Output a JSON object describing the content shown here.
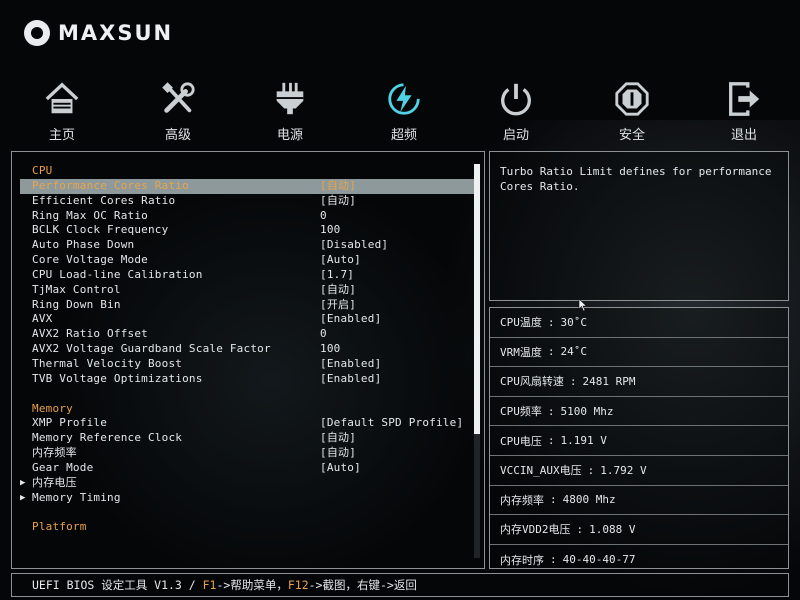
{
  "header": {
    "brand": "MAXSUN"
  },
  "nav": [
    {
      "label": "主页",
      "icon": "home-icon"
    },
    {
      "label": "高级",
      "icon": "tools-icon"
    },
    {
      "label": "电源",
      "icon": "power-plug-icon"
    },
    {
      "label": "超频",
      "icon": "lightning-icon"
    },
    {
      "label": "启动",
      "icon": "power-button-icon"
    },
    {
      "label": "安全",
      "icon": "security-icon"
    },
    {
      "label": "退出",
      "icon": "exit-icon"
    }
  ],
  "active_nav": "超频",
  "settings": {
    "rows": [
      {
        "type": "section",
        "label": "CPU",
        "value": ""
      },
      {
        "type": "item",
        "label": "Performance Cores Ratio",
        "value": "[自动]",
        "selected": true
      },
      {
        "type": "item",
        "label": "Efficient Cores Ratio",
        "value": "[自动]"
      },
      {
        "type": "item",
        "label": "Ring Max OC Ratio",
        "value": "0"
      },
      {
        "type": "item",
        "label": "BCLK Clock Frequency",
        "value": "100"
      },
      {
        "type": "item",
        "label": "Auto Phase Down",
        "value": "[Disabled]"
      },
      {
        "type": "item",
        "label": "Core Voltage Mode",
        "value": "[Auto]"
      },
      {
        "type": "item",
        "label": "CPU Load-line Calibration",
        "value": "[1.7]"
      },
      {
        "type": "item",
        "label": "TjMax Control",
        "value": "[自动]"
      },
      {
        "type": "item",
        "label": "Ring Down Bin",
        "value": "[开启]"
      },
      {
        "type": "item",
        "label": "AVX",
        "value": "[Enabled]"
      },
      {
        "type": "item",
        "label": "AVX2 Ratio Offset",
        "value": "0"
      },
      {
        "type": "item",
        "label": "AVX2 Voltage Guardband Scale Factor",
        "value": "100"
      },
      {
        "type": "item",
        "label": "Thermal Velocity Boost",
        "value": "[Enabled]"
      },
      {
        "type": "item",
        "label": "TVB Voltage Optimizations",
        "value": "[Enabled]"
      },
      {
        "type": "blank",
        "label": "",
        "value": ""
      },
      {
        "type": "section",
        "label": "Memory",
        "value": ""
      },
      {
        "type": "item",
        "label": "XMP Profile",
        "value": "[Default SPD Profile]"
      },
      {
        "type": "item",
        "label": "Memory Reference Clock",
        "value": "[自动]"
      },
      {
        "type": "item",
        "label": "内存频率",
        "value": "[自动]"
      },
      {
        "type": "item",
        "label": "Gear Mode",
        "value": "[Auto]"
      },
      {
        "type": "sub",
        "label": "内存电压",
        "value": ""
      },
      {
        "type": "sub",
        "label": "Memory Timing",
        "value": ""
      },
      {
        "type": "blank",
        "label": "",
        "value": ""
      },
      {
        "type": "section",
        "label": "Platform",
        "value": ""
      }
    ]
  },
  "help": {
    "text": "Turbo Ratio Limit defines for performance Cores Ratio."
  },
  "status": [
    {
      "label": "CPU温度",
      "value": "30˚C"
    },
    {
      "label": "VRM温度",
      "value": "24˚C"
    },
    {
      "label": "CPU风扇转速",
      "value": "2481 RPM"
    },
    {
      "label": "CPU频率",
      "value": "5100 Mhz"
    },
    {
      "label": "CPU电压",
      "value": "1.191 V"
    },
    {
      "label": "VCCIN_AUX电压",
      "value": "1.792 V"
    },
    {
      "label": "内存频率",
      "value": "4800 Mhz"
    },
    {
      "label": "内存VDD2电压",
      "value": "1.088 V"
    },
    {
      "label": "内存时序",
      "value": "40-40-40-77"
    }
  ],
  "footer": {
    "prefix": "UEFI BIOS 设定工具 V1.3 / ",
    "key1": "F1",
    "text1": "->帮助菜单，",
    "key2": "F12",
    "text2": "->截图，右键->返回"
  },
  "colors": {
    "accent": "#e9a14a",
    "selection": "#8e999c",
    "active_icon": "#4fd2e6",
    "icon": "#c9cfd2"
  }
}
